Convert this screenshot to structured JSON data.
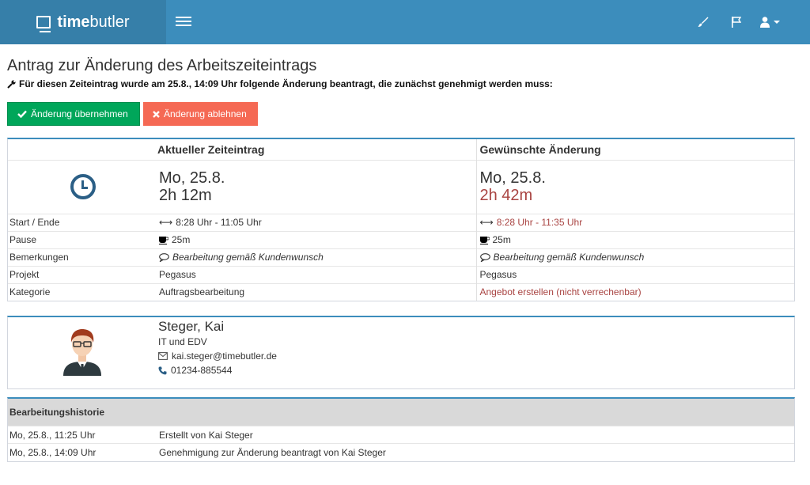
{
  "navbar": {
    "brand_bold": "time",
    "brand_thin": "butler",
    "icons": [
      "menu-icon",
      "brush-icon",
      "flag-icon",
      "user-icon",
      "caret-down-icon"
    ],
    "color": "#3c8dbc",
    "brand_color": "#367fa9"
  },
  "page": {
    "title": "Antrag zur Änderung des Arbeitszeiteintrags",
    "subtitle": "Für diesen Zeiteintrag wurde am 25.8., 14:09 Uhr folgende Änderung beantragt, die zunächst genehmigt werden muss:"
  },
  "actions": {
    "accept_label": "Änderung übernehmen",
    "reject_label": "Änderung ablehnen",
    "accept_color": "#00a65a",
    "reject_color": "#f56954"
  },
  "comparison": {
    "header_current": "Aktueller Zeiteintrag",
    "header_requested": "Gewünschte Änderung",
    "current": {
      "date": "Mo, 25.8.",
      "duration": "2h 12m"
    },
    "requested": {
      "date": "Mo, 25.8.",
      "duration": "2h 42m"
    },
    "rows": [
      {
        "label": "Start / Ende",
        "current": "8:28 Uhr - 11:05 Uhr",
        "requested": "8:28 Uhr - 11:35 Uhr"
      },
      {
        "label": "Pause",
        "current": "25m",
        "requested": "25m"
      },
      {
        "label": "Bemerkungen",
        "current": "Bearbeitung gemäß Kundenwunsch",
        "requested": "Bearbeitung gemäß Kundenwunsch"
      },
      {
        "label": "Projekt",
        "current": "Pegasus",
        "requested": "Pegasus"
      },
      {
        "label": "Kategorie",
        "current": "Auftragsbearbeitung",
        "requested": "Angebot erstellen (nicht verrechenbar)"
      }
    ],
    "changed_color": "#a94442"
  },
  "employee": {
    "name": "Steger, Kai",
    "department": "IT und EDV",
    "email": "kai.steger@timebutler.de",
    "phone": "01234-885544"
  },
  "history": {
    "title": "Bearbeitungshistorie",
    "rows": [
      {
        "time": "Mo, 25.8., 11:25 Uhr",
        "text": "Erstellt von Kai Steger"
      },
      {
        "time": "Mo, 25.8., 14:09 Uhr",
        "text": "Genehmigung zur Änderung beantragt von Kai Steger"
      }
    ]
  }
}
